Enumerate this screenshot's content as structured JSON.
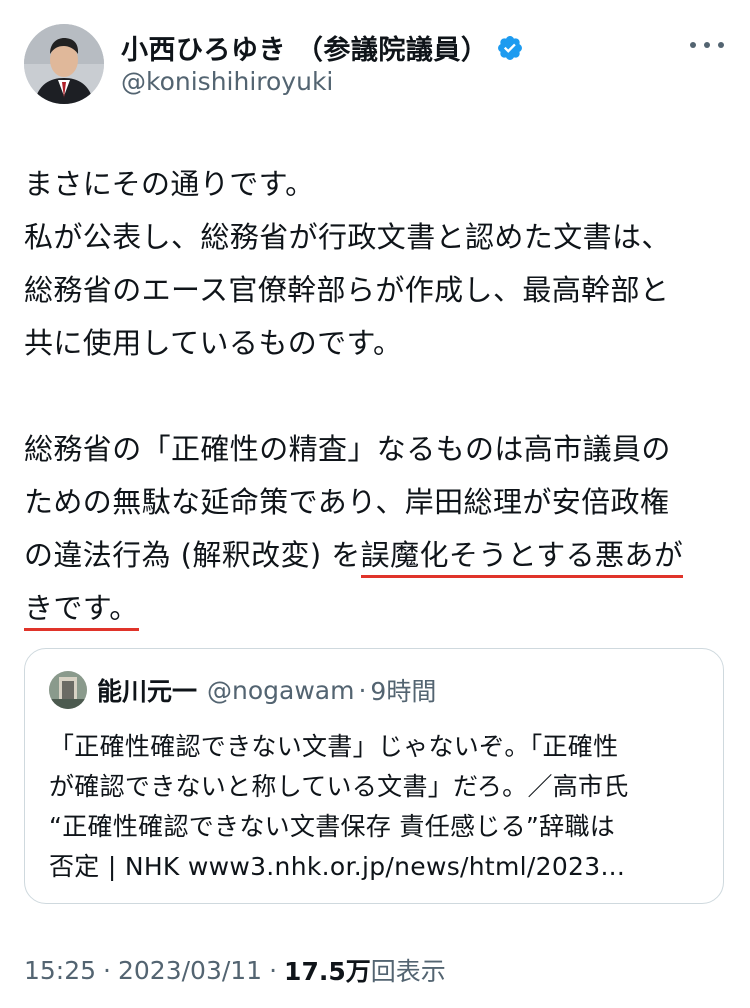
{
  "author": {
    "display_name": "小西ひろゆき （参議院議員）",
    "handle": "@konishihiroyuki",
    "verified": true
  },
  "tweet": {
    "lines": [
      "まさにその通りです。",
      "私が公表し、総務省が行政文書と認めた文書は、",
      "総務省のエース官僚幹部らが作成し、最高幹部と",
      "共に使用しているものです。",
      "",
      "総務省の「正確性の精査」なるものは高市議員の",
      "ための無駄な延命策であり、岸田総理が安倍政権"
    ],
    "line8_plain": "の違法行為 (解釈改変) を",
    "line8_underlined": "誤魔化そうとする悪あが",
    "line9_underlined": "きです。"
  },
  "quoted_tweet": {
    "display_name": "能川元一",
    "handle": "@nogawam",
    "separator": "·",
    "time": "9時間",
    "lines": [
      "「正確性確認できない文書」じゃないぞ。「正確性",
      "が確認できないと称している文書」だろ。／高市氏",
      "“正確性確認できない文書保存 責任感じる”辞職は",
      "否定 | NHK www3.nhk.or.jp/news/html/2023..."
    ]
  },
  "footer": {
    "time": "15:25",
    "sep1": "·",
    "date": "2023/03/11",
    "sep2": "·",
    "views_count": "17.5万",
    "views_label": "回表示"
  },
  "colors": {
    "verified_badge": "#1d9bf0",
    "underline": "#e0342a",
    "secondary_text": "#536471"
  }
}
